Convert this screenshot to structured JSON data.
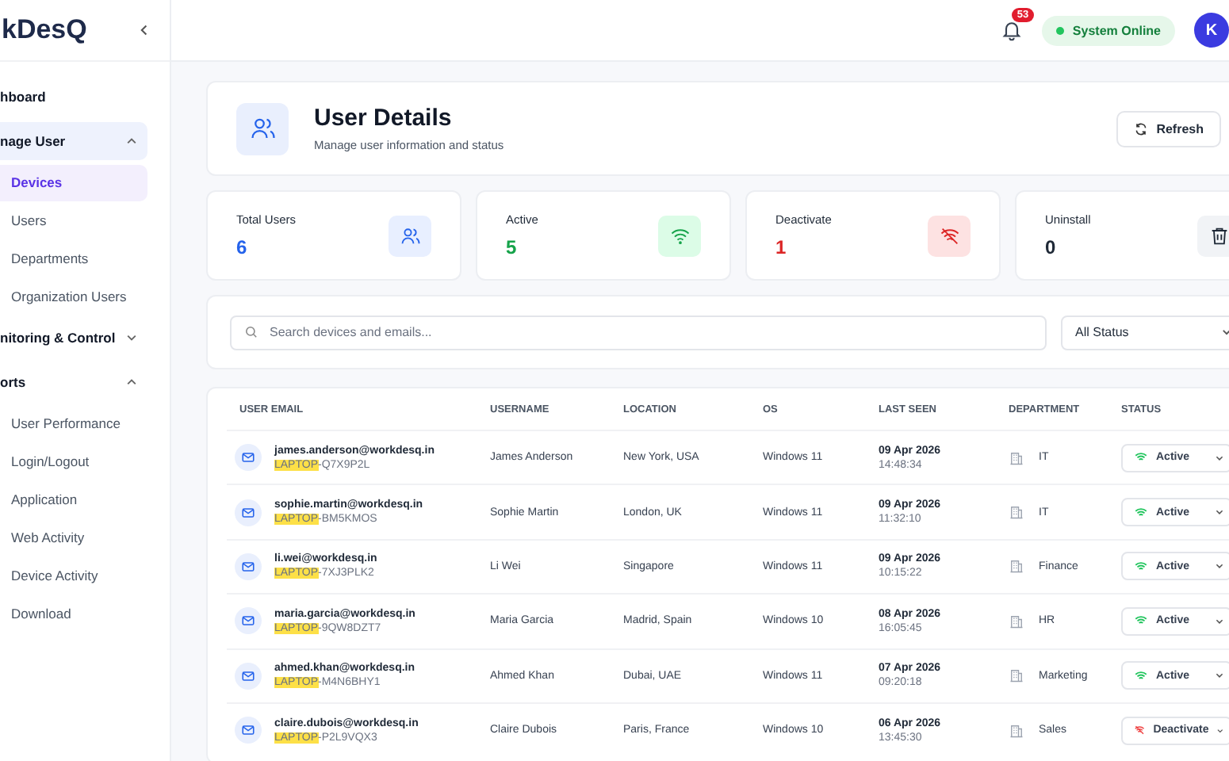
{
  "sidebar": {
    "logo": "kDesQ",
    "items": [
      {
        "label": "hboard",
        "selected": false
      },
      {
        "label": "nage User",
        "expanded": true,
        "selected": true,
        "children": [
          {
            "label": "Devices",
            "selected": true
          },
          {
            "label": "Users",
            "selected": false
          },
          {
            "label": "Departments",
            "selected": false
          },
          {
            "label": "Organization Users",
            "selected": false
          }
        ]
      },
      {
        "label": "nitoring & Control",
        "expanded": false,
        "selected": false
      },
      {
        "label": "orts",
        "expanded": true,
        "selected": false,
        "children": [
          {
            "label": "User Performance",
            "selected": false
          },
          {
            "label": "Login/Logout",
            "selected": false
          },
          {
            "label": "Application",
            "selected": false
          },
          {
            "label": "Web Activity",
            "selected": false
          },
          {
            "label": "Device Activity",
            "selected": false
          },
          {
            "label": "Download",
            "selected": false
          }
        ]
      }
    ]
  },
  "topbar": {
    "notifications": "53",
    "system_status": "System Online",
    "avatar": "K"
  },
  "header": {
    "title": "User Details",
    "subtitle": "Manage user information and status",
    "refresh": "Refresh"
  },
  "stats": [
    {
      "kind": "total",
      "label": "Total Users",
      "value": "6"
    },
    {
      "kind": "active",
      "label": "Active",
      "value": "5"
    },
    {
      "kind": "deactivate",
      "label": "Deactivate",
      "value": "1"
    },
    {
      "kind": "uninstall",
      "label": "Uninstall",
      "value": "0"
    }
  ],
  "filters": {
    "search": {
      "placeholder": "Search devices and emails..."
    },
    "status": "All Status"
  },
  "table": {
    "columns": [
      "USER EMAIL",
      "USERNAME",
      "LOCATION",
      "OS",
      "LAST SEEN",
      "DEPARTMENT",
      "STATUS"
    ],
    "rows": [
      {
        "email": "james.anderson@workdesq.in",
        "device_match": "LAPTOP",
        "device_rest": "-Q7X9P2L",
        "username": "James Anderson",
        "location": "New York, USA",
        "os": "Windows 11",
        "date": "09 Apr 2026",
        "time": "14:48:34",
        "department": "IT",
        "status": {
          "kind": "active",
          "label": "Active"
        }
      },
      {
        "email": "sophie.martin@workdesq.in",
        "device_match": "LAPTOP",
        "device_rest": "-BM5KMOS",
        "username": "Sophie Martin",
        "location": "London, UK",
        "os": "Windows 11",
        "date": "09 Apr 2026",
        "time": "11:32:10",
        "department": "IT",
        "status": {
          "kind": "active",
          "label": "Active"
        }
      },
      {
        "email": "li.wei@workdesq.in",
        "device_match": "LAPTOP",
        "device_rest": "-7XJ3PLK2",
        "username": "Li Wei",
        "location": "Singapore",
        "os": "Windows 11",
        "date": "09 Apr 2026",
        "time": "10:15:22",
        "department": "Finance",
        "status": {
          "kind": "active",
          "label": "Active"
        }
      },
      {
        "email": "maria.garcia@workdesq.in",
        "device_match": "LAPTOP",
        "device_rest": "-9QW8DZT7",
        "username": "Maria Garcia",
        "location": "Madrid, Spain",
        "os": "Windows 10",
        "date": "08 Apr 2026",
        "time": "16:05:45",
        "department": "HR",
        "status": {
          "kind": "active",
          "label": "Active"
        }
      },
      {
        "email": "ahmed.khan@workdesq.in",
        "device_match": "LAPTOP",
        "device_rest": "-M4N6BHY1",
        "username": "Ahmed Khan",
        "location": "Dubai, UAE",
        "os": "Windows 11",
        "date": "07 Apr 2026",
        "time": "09:20:18",
        "department": "Marketing",
        "status": {
          "kind": "active",
          "label": "Active"
        }
      },
      {
        "email": "claire.dubois@workdesq.in",
        "device_match": "LAPTOP",
        "device_rest": "-P2L9VQX3",
        "username": "Claire Dubois",
        "location": "Paris, France",
        "os": "Windows 10",
        "date": "06 Apr 2026",
        "time": "13:45:30",
        "department": "Sales",
        "status": {
          "kind": "deactivate",
          "label": "Deactivate"
        }
      }
    ]
  }
}
